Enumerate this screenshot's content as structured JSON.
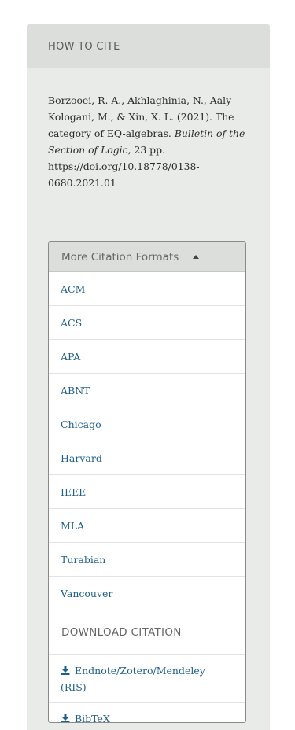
{
  "how_to_cite": {
    "header": "HOW TO CITE",
    "authors_year": "Borzooei, R. A., Akhlaghinia, N., Aaly Kologani, M., & Xin, X. L. (2021). The category of EQ-algebras.",
    "journal": "Bulletin of the Section of Logic",
    "pages": ", 23 pp.",
    "doi": "https://doi.org/10.18778/0138-0680.2021.01"
  },
  "formats": {
    "toggle_label": "More Citation Formats",
    "items": [
      "ACM",
      "ACS",
      "APA",
      "ABNT",
      "Chicago",
      "Harvard",
      "IEEE",
      "MLA",
      "Turabian",
      "Vancouver"
    ]
  },
  "download": {
    "header": "DOWNLOAD CITATION",
    "icon": "download-icon",
    "items": [
      "Endnote/Zotero/Mendeley (RIS)",
      "BibTeX"
    ]
  },
  "colors": {
    "link": "#1f5f8b",
    "panel_bg": "#e9ebe8",
    "header_bg": "#dcdedb"
  }
}
